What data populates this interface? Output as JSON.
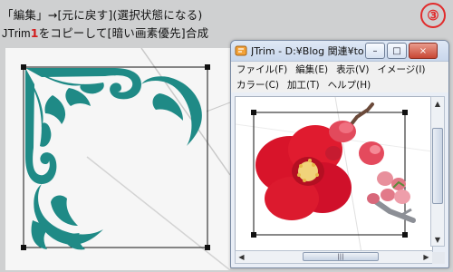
{
  "caption": {
    "line1": "「編集」→[元に戻す](選択状態になる)",
    "line2_app": "JTrim",
    "line2_digit": "1",
    "line2_rest": "をコピーして[暗い画素優先]合成"
  },
  "step_badge": "③",
  "window": {
    "title": "JTrim - D:¥Blog 関連¥to...",
    "minimize_symbol": "–",
    "maximize_symbol": "□",
    "close_symbol": "×",
    "menu_row1": [
      "ファイル(F)",
      "編集(E)",
      "表示(V)",
      "イメージ(I)"
    ],
    "menu_row2": [
      "カラー(C)",
      "加工(T)",
      "ヘルプ(H)"
    ],
    "hscroll_grip": "|||",
    "scroll_up": "▲",
    "scroll_down": "▼",
    "scroll_left": "◀",
    "scroll_right": "▶"
  },
  "colors": {
    "ornament": "#1f8a86",
    "flower": "#e0162b",
    "badge": "#e12b2b",
    "caption_digit": "#d21c1c"
  }
}
